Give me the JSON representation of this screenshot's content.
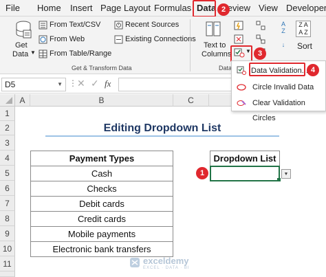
{
  "ribbon_tabs": [
    "File",
    "Home",
    "Insert",
    "Page Layout",
    "Formulas",
    "Data",
    "Review",
    "View",
    "Developer"
  ],
  "active_tab": "Data",
  "step_badges": [
    "1",
    "2",
    "3",
    "4"
  ],
  "get_transform": {
    "get_data_line1": "Get",
    "get_data_line2": "Data",
    "from_text_csv": "From Text/CSV",
    "from_web": "From Web",
    "from_table_range": "From Table/Range",
    "recent_sources": "Recent Sources",
    "existing_connections": "Existing Connections",
    "group_label": "Get & Transform Data"
  },
  "data_tools": {
    "text_to_line1": "Text to",
    "text_to_line2": "Columns",
    "group_label_partial": "Data",
    "sort": "Sort",
    "sort_az_top": "A",
    "sort_az_bottom": "Z",
    "sort_big_top": "Z A",
    "sort_big_bottom": "A Z"
  },
  "data_validation_menu": [
    "Data Validation...",
    "Circle Invalid Data",
    "Clear Validation Circles"
  ],
  "formula_bar": {
    "name_box": "D5",
    "fx": "fx",
    "value": ""
  },
  "columns": [
    "A",
    "B",
    "C",
    "D"
  ],
  "rows": [
    "1",
    "2",
    "3",
    "4",
    "5",
    "6",
    "7",
    "8",
    "9",
    "10",
    "11"
  ],
  "sheet": {
    "title": "Editing Dropdown List",
    "payment_header": "Payment Types",
    "payment_types": [
      "Cash",
      "Checks",
      "Debit cards",
      "Credit cards",
      "Mobile payments",
      "Electronic bank transfers"
    ],
    "dropdown_header": "Dropdown List",
    "dropdown_value": ""
  },
  "watermark": {
    "name": "exceldemy",
    "tagline": "EXCEL · DATA · BI"
  },
  "colors": {
    "accent_red": "#e0282e",
    "excel_green": "#217346",
    "title_underline": "#9dc3e6",
    "ribbon_bg": "#f3f3f3"
  }
}
